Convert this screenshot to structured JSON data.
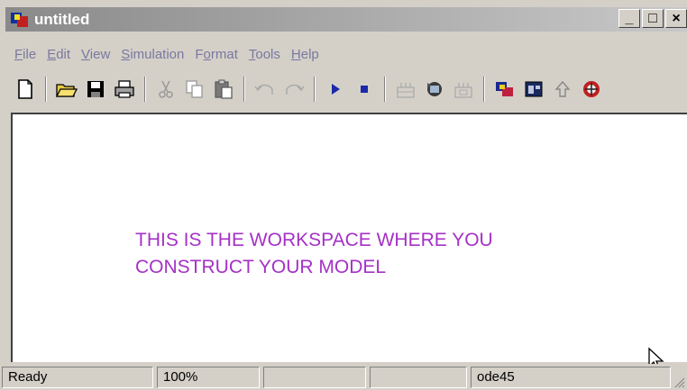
{
  "window": {
    "title": "untitled",
    "minimize_glyph": "_",
    "maximize_glyph": "□",
    "close_glyph": "×"
  },
  "menu": {
    "items": [
      {
        "label": "File"
      },
      {
        "label": "Edit"
      },
      {
        "label": "View"
      },
      {
        "label": "Simulation"
      },
      {
        "label": "Format"
      },
      {
        "label": "Tools"
      },
      {
        "label": "Help"
      }
    ]
  },
  "toolbar": {
    "icons": [
      "new-document-icon",
      "open-folder-icon",
      "save-icon",
      "print-icon",
      "cut-icon",
      "copy-icon",
      "paste-icon",
      "undo-icon",
      "redo-icon",
      "start-simulation-icon",
      "stop-simulation-icon",
      "build-icon",
      "update-diagram-icon",
      "build-subsystem-icon",
      "library-browser-icon",
      "model-browser-icon",
      "go-to-parent-icon",
      "debugger-icon"
    ]
  },
  "workspace": {
    "line1": "THIS IS THE WORKSPACE WHERE YOU",
    "line2": "CONSTRUCT YOUR MODEL",
    "text_color": "#a531c6"
  },
  "status": {
    "state": "Ready",
    "zoom": "100%",
    "solver": "ode45"
  }
}
